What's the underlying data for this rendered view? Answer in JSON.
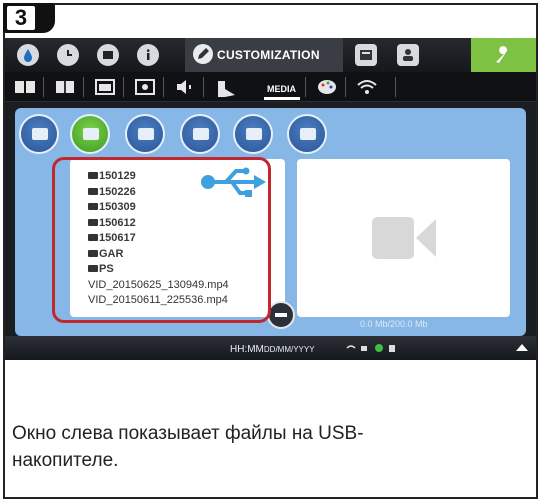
{
  "step_number": "3",
  "topbar": {
    "active_tab_label": "CUSTOMIZATION",
    "icons": [
      "droplet-icon",
      "clock-icon",
      "display-icon",
      "info-icon",
      "pen-icon",
      "screen-icon",
      "user-icon",
      "wrench-icon"
    ]
  },
  "subbar": {
    "media_label": "MEDIA",
    "icons": [
      "book-icon",
      "book-open-icon",
      "picture-icon",
      "image-frame-icon",
      "speaker-icon",
      "media-icon",
      "palette-icon",
      "wifi-icon"
    ]
  },
  "media_categories": [
    {
      "name": "photos",
      "active": false
    },
    {
      "name": "video",
      "active": true
    },
    {
      "name": "tv",
      "active": false
    },
    {
      "name": "camera",
      "active": false
    },
    {
      "name": "gallery",
      "active": false
    },
    {
      "name": "grid",
      "active": false
    }
  ],
  "files": [
    {
      "name": "150129",
      "type": "folder"
    },
    {
      "name": "150226",
      "type": "folder"
    },
    {
      "name": "150309",
      "type": "folder"
    },
    {
      "name": "150612",
      "type": "folder"
    },
    {
      "name": "150617",
      "type": "folder"
    },
    {
      "name": "GAR",
      "type": "folder"
    },
    {
      "name": "PS",
      "type": "folder"
    },
    {
      "name": "VID_20150625_130949.mp4",
      "type": "file"
    },
    {
      "name": "VID_20150611_225536.mp4",
      "type": "file"
    }
  ],
  "capacity": "0.0 Mb/200.0 Mb",
  "bottombar": {
    "time": "HH:MM",
    "date": "DD/MM/YYYY"
  },
  "description": "Окно слева показывает файлы на USB-накопителе.",
  "colors": {
    "accent_green": "#7dc242",
    "panel_blue": "#86b7e6",
    "highlight_red": "#c0282d"
  }
}
